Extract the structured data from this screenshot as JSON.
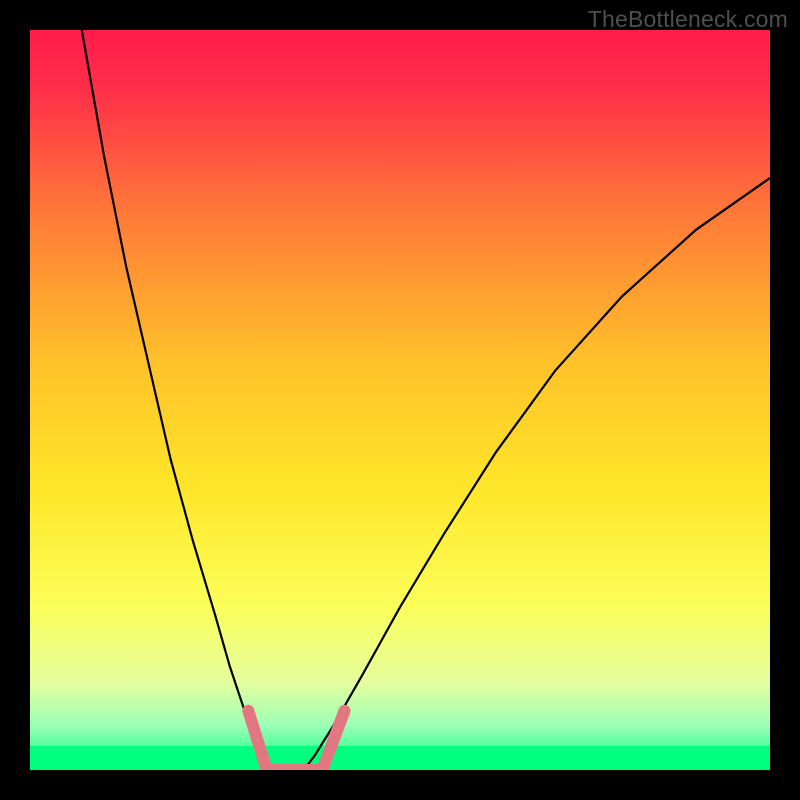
{
  "watermark": {
    "text": "TheBottleneck.com"
  },
  "colors": {
    "gradient_stops": [
      {
        "pct": 0,
        "color": "#ff1c49"
      },
      {
        "pct": 8,
        "color": "#ff2f49"
      },
      {
        "pct": 25,
        "color": "#ff7a38"
      },
      {
        "pct": 45,
        "color": "#ffc22a"
      },
      {
        "pct": 62,
        "color": "#ffe62a"
      },
      {
        "pct": 78,
        "color": "#fbff5a"
      },
      {
        "pct": 88,
        "color": "#e6ff9e"
      },
      {
        "pct": 94,
        "color": "#9cffb6"
      },
      {
        "pct": 100,
        "color": "#00ff7e"
      }
    ],
    "band_color": "#00ff7e",
    "marker_color": "#e27782",
    "curve_color": "#000000",
    "frame_color": "#000000"
  },
  "chart_data": {
    "type": "line",
    "title": "",
    "xlabel": "",
    "ylabel": "",
    "xlim": [
      0,
      100
    ],
    "ylim": [
      0,
      100
    ],
    "grid": false,
    "legend": false,
    "series": [
      {
        "name": "left-branch",
        "x": [
          7,
          10,
          13,
          16,
          19,
          22,
          25,
          27,
          29,
          30.5,
          31.5,
          32
        ],
        "values": [
          100,
          83,
          68,
          55,
          42,
          31,
          21,
          14,
          8,
          4,
          1.5,
          0
        ]
      },
      {
        "name": "right-branch",
        "x": [
          37,
          38.5,
          41,
          45,
          50,
          56,
          63,
          71,
          80,
          90,
          100
        ],
        "values": [
          0,
          2,
          6,
          13,
          22,
          32,
          43,
          54,
          64,
          73,
          80
        ]
      }
    ],
    "flat_segment": {
      "x": [
        32,
        37
      ],
      "values": [
        0,
        0
      ]
    },
    "markers": [
      {
        "name": "left-marker",
        "x": [
          29.5,
          32
        ],
        "values": [
          8,
          0
        ]
      },
      {
        "name": "bottom-marker",
        "x": [
          32,
          39.5
        ],
        "values": [
          0,
          0
        ]
      },
      {
        "name": "right-marker",
        "x": [
          39.5,
          42.5
        ],
        "values": [
          0,
          8
        ]
      }
    ],
    "green_band": {
      "y_from": 0,
      "y_to": 3.2
    }
  }
}
